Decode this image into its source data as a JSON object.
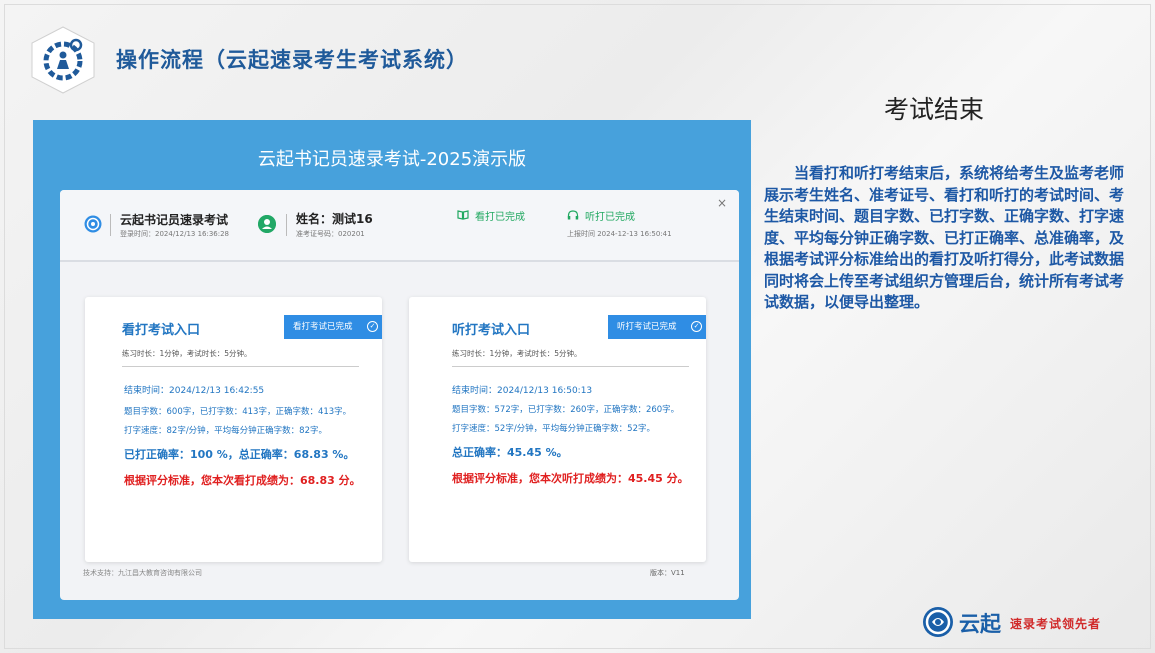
{
  "header": {
    "title": "操作流程（云起速录考生考试系统）",
    "logo_icon": "gear-person-icon"
  },
  "section": {
    "title": "考试结束",
    "body": "当看打和听打考结束后，系统将给考生及监考老师展示考生姓名、准考证号、看打和听打的考试时间、考生结束时间、题目字数、已打字数、正确字数、打字速度、平均每分钟正确字数、已打正确率、总准确率，及根据考试评分标准给出的看打及听打得分，此考试数据同时将会上传至考试组织方管理后台，统计所有考试考试数据，以便导出整理。"
  },
  "brand": {
    "name": "云起",
    "slogan": "速录考试领先者"
  },
  "app": {
    "title": "云起书记员速录考试-2025演示版",
    "info_bar": {
      "exam_name": "云起书记员速录考试",
      "login_time": "登录时间：2024/12/13 16:36:28",
      "name": "姓名：测试16",
      "ticket": "准考证号码：020201",
      "typed_status": "看打已完成",
      "heard_status": "听打已完成",
      "upload_time": "上报时间 2024-12-13 16:50:41",
      "close": "×"
    },
    "cards": [
      {
        "title": "看打考试入口",
        "badge": "看打考试已完成",
        "meta": "练习时长：1分钟，考试时长：5分钟。",
        "end_time": "结束时间：2024/12/13 16:42:55",
        "counts": "题目字数：600字，已打字数：413字，正确字数：413字。",
        "speed": "打字速度：82字/分钟，平均每分钟正确字数：82字。",
        "accuracy": "已打正确率：100 %，总正确率：68.83 %。",
        "score": "根据评分标准，您本次看打成绩为：68.83 分。"
      },
      {
        "title": "听打考试入口",
        "badge": "听打考试已完成",
        "meta": "练习时长：1分钟，考试时长：5分钟。",
        "end_time": "结束时间：2024/12/13 16:50:13",
        "counts": "题目字数：572字，已打字数：260字，正确字数：260字。",
        "speed": "打字速度：52字/分钟，平均每分钟正确字数：52字。",
        "accuracy": "总正确率：45.45 %。",
        "score": "根据评分标准，您本次听打成绩为：45.45 分。"
      }
    ],
    "footer": {
      "support": "技术支持：九江昌大教育咨询有限公司",
      "version": "版本：V11"
    }
  },
  "colors": {
    "accent_blue": "#47a1dc",
    "title_blue": "#1f5a9a",
    "success_green": "#20a860",
    "score_red": "#e02020"
  }
}
